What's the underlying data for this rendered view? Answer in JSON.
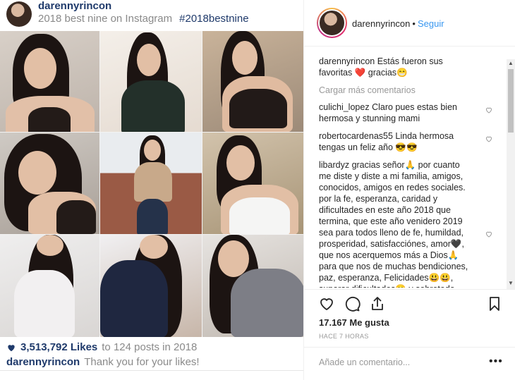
{
  "media": {
    "username": "darennyrincon",
    "subtitle": "2018 best nine on Instagram",
    "hashtag": "#2018bestnine",
    "likes_count": "3,513,792 Likes",
    "likes_context": "to 124 posts in 2018",
    "thanks_user": "darennyrincon",
    "thanks_text": "Thank you for your likes!"
  },
  "side": {
    "username": "darennyrincon",
    "dot": "•",
    "follow_label": "Seguir",
    "caption_user": "darennyrincon",
    "caption_text": "Estás fueron sus favoritas ❤️ gracias😁",
    "load_more": "Cargar más comentarios",
    "comments": [
      {
        "user": "culichi_lopez",
        "text": "Claro pues estas bien hermosa y stunning mami"
      },
      {
        "user": "robertocardenas55",
        "text": "Linda hermosa tengas un feliz año 😎😎"
      },
      {
        "user": "libardyz",
        "text": "gracias señor🙏 por cuanto me diste y diste a mi familia, amigos, conocidos, amigos en redes sociales. por la fe, esperanza, caridad y dificultades en este año 2018 que termina, que este año venidero 2019 sea para todos lleno de fe, humildad, prosperidad, satisfacciónes, amor🖤, que nos acerquemos más a Dios🙏 para que nos de muchas bendiciones, paz, esperanza, Felicidades😃😃, superar dificultades😀 y sobretodo"
      }
    ],
    "likes": "17.167 Me gusta",
    "time": "HACE 7 HORAS",
    "add_comment_placeholder": "Añade un comentario...",
    "more_label": "•••"
  },
  "colors": {
    "link_blue": "#3897f0",
    "username_navy": "#1f3a6b",
    "heart_red": "#ed4956"
  },
  "icons": [
    "heart-icon",
    "comment-icon",
    "share-icon",
    "bookmark-icon",
    "heart-outline-icon"
  ]
}
